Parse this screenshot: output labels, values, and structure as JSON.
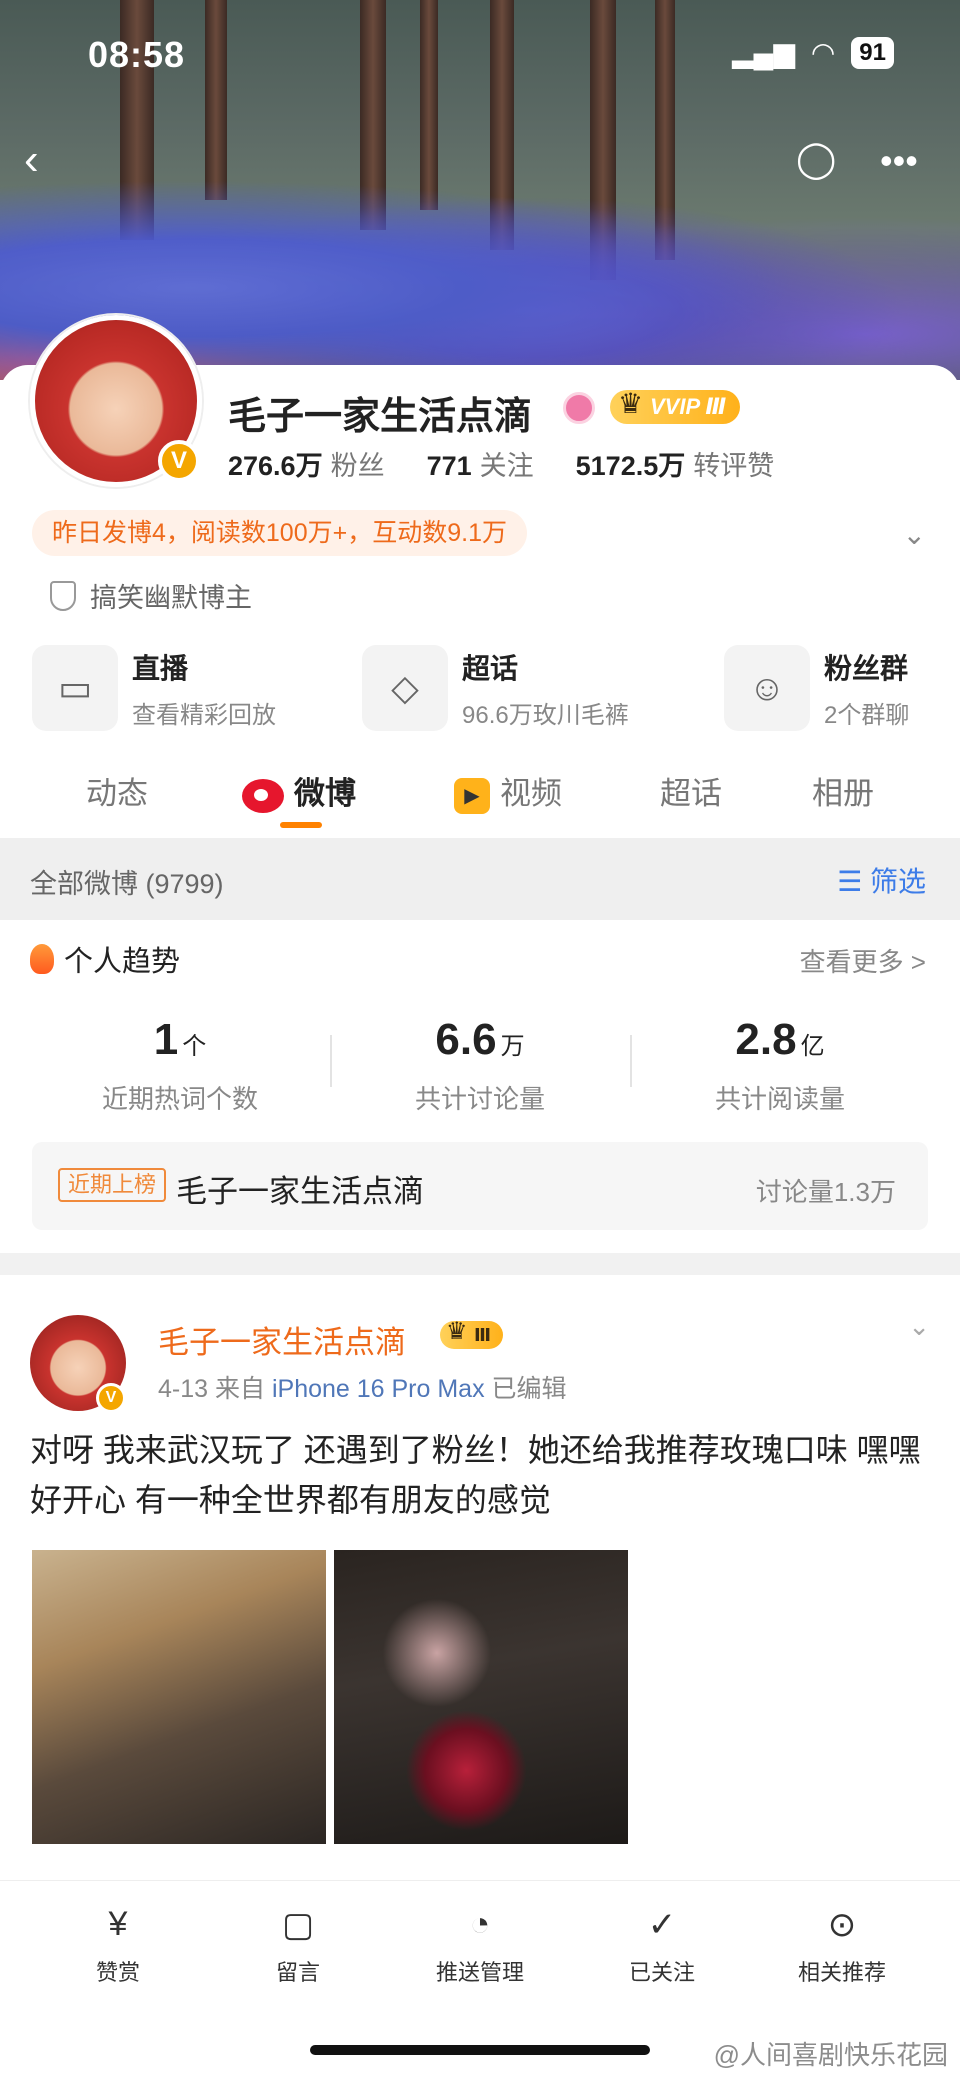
{
  "status_bar": {
    "time": "08:58",
    "battery": "91"
  },
  "profile": {
    "name": "毛子一家生活点滴",
    "vip_label": "VVIP Ⅲ",
    "verified_badge": "V",
    "stats": [
      {
        "value": "276.6万",
        "label": "粉丝"
      },
      {
        "value": "771",
        "label": "关注"
      },
      {
        "value": "5172.5万",
        "label": "转评赞"
      }
    ],
    "activity": "昨日发博4，阅读数100万+，互动数9.1万",
    "tag": "搞笑幽默博主"
  },
  "shortcuts": [
    {
      "title": "直播",
      "sub": "查看精彩回放",
      "icon": "tv-icon"
    },
    {
      "title": "超话",
      "sub": "96.6万玫川毛裤",
      "icon": "diamond-icon"
    },
    {
      "title": "粉丝群",
      "sub": "2个群聊",
      "icon": "group-icon"
    }
  ],
  "tabs": [
    "动态",
    "微博",
    "视频",
    "超话",
    "相册"
  ],
  "active_tab": "微博",
  "filter": {
    "left": "全部微博 (9799)",
    "right": "筛选"
  },
  "trend": {
    "title": "个人趋势",
    "more": "查看更多 >",
    "metrics": [
      {
        "value": "1",
        "unit": "个",
        "label": "近期热词个数"
      },
      {
        "value": "6.6",
        "unit": "万",
        "label": "共计讨论量"
      },
      {
        "value": "2.8",
        "unit": "亿",
        "label": "共计阅读量"
      }
    ],
    "rank": {
      "badge": "近期上榜",
      "name": "毛子一家生活点滴",
      "discussion": "讨论量1.3万"
    }
  },
  "post": {
    "author": "毛子一家生活点滴",
    "crown": "Ⅲ",
    "date": "4-13",
    "from": "来自",
    "device": "iPhone 16 Pro Max",
    "edited": "已编辑",
    "text": "对呀 我来武汉玩了 还遇到了粉丝！她还给我推荐玫瑰口味 嘿嘿 好开心 有一种全世界都有朋友的感觉"
  },
  "bottom_bar": [
    {
      "label": "赞赏",
      "icon": "reward-icon"
    },
    {
      "label": "留言",
      "icon": "message-icon"
    },
    {
      "label": "推送管理",
      "icon": "bell-icon"
    },
    {
      "label": "已关注",
      "icon": "followed-icon"
    },
    {
      "label": "相关推荐",
      "icon": "recommend-icon"
    }
  ],
  "watermark": "@人间喜剧快乐花园",
  "colors": {
    "accent": "#ff8200",
    "name_orange": "#ee6a1b",
    "link_blue": "#3d7ce8",
    "vip_gold": "#ffb11a"
  }
}
